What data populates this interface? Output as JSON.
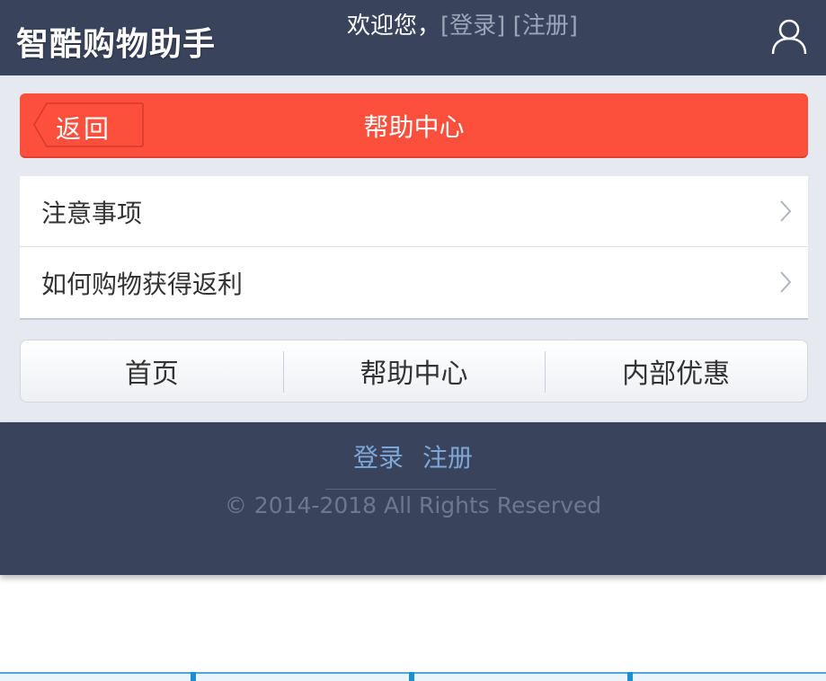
{
  "header": {
    "logo": "智酷购物助手",
    "welcome": "欢迎您，",
    "login_link": "[登录]",
    "register_link": "[注册]",
    "user_icon": "user-icon"
  },
  "titlebar": {
    "back_label": "返回",
    "title": "帮助中心"
  },
  "list": {
    "items": [
      {
        "label": "注意事项"
      },
      {
        "label": "如何购物获得返利"
      }
    ]
  },
  "nav": {
    "items": [
      {
        "label": "首页"
      },
      {
        "label": "帮助中心"
      },
      {
        "label": "内部优惠"
      }
    ]
  },
  "footer": {
    "login": "登录",
    "register": "注册",
    "copyright": "© 2014-2018 All Rights Reserved"
  },
  "colors": {
    "header_bg": "#3a435c",
    "accent_red": "#fc4f3c",
    "link_blue": "#7da7d8"
  }
}
